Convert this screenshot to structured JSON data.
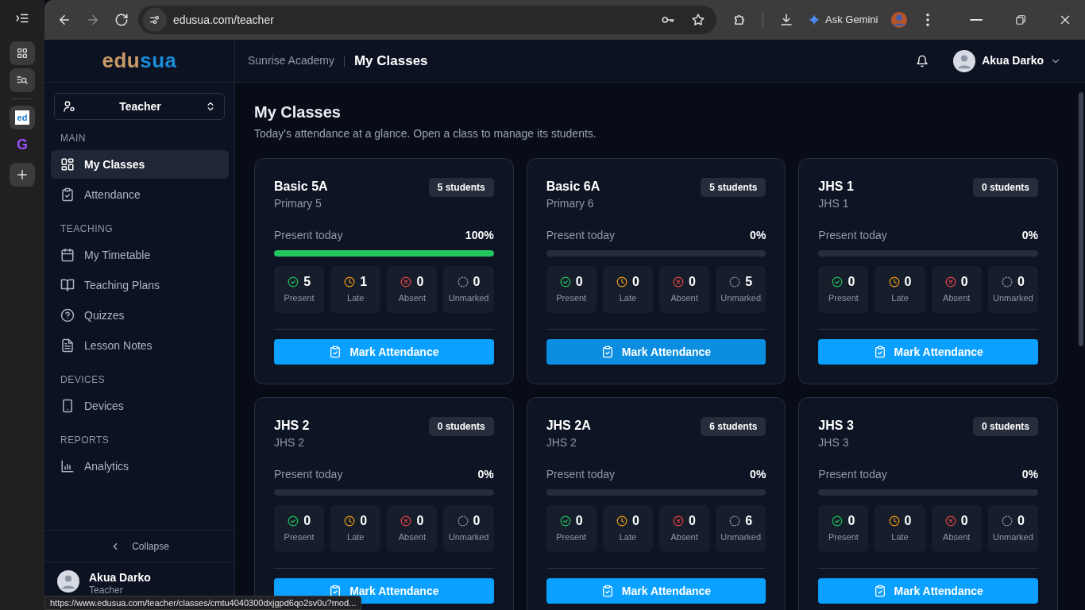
{
  "browser": {
    "tabs": [
      {
        "favicon": "ed",
        "kind": "edusua",
        "selected": true
      },
      {
        "favicon": "G",
        "kind": "purple",
        "selected": false
      }
    ],
    "url": "edusua.com/teacher",
    "assistant": "Ask Gemini",
    "status_url": "https://www.edusua.com/teacher/classes/cmtu4040300dxjgpd6qo2sv0u?mod..."
  },
  "sidebar": {
    "logo_first": "edu",
    "logo_second": "sua",
    "role": "Teacher",
    "sections": [
      {
        "title": "MAIN",
        "items": [
          {
            "label": "My Classes",
            "kind": "grid",
            "selected": true
          },
          {
            "label": "Attendance",
            "kind": "clipboard",
            "selected": false
          }
        ]
      },
      {
        "title": "TEACHING",
        "items": [
          {
            "label": "My Timetable",
            "kind": "calendar",
            "selected": false
          },
          {
            "label": "Teaching Plans",
            "kind": "book",
            "selected": false
          },
          {
            "label": "Quizzes",
            "kind": "help",
            "selected": false
          },
          {
            "label": "Lesson Notes",
            "kind": "file",
            "selected": false
          }
        ]
      },
      {
        "title": "DEVICES",
        "items": [
          {
            "label": "Devices",
            "kind": "phone",
            "selected": false
          }
        ]
      },
      {
        "title": "REPORTS",
        "items": [
          {
            "label": "Analytics",
            "kind": "chart",
            "selected": false
          }
        ]
      }
    ],
    "collapse": "Collapse",
    "user": {
      "name": "Akua Darko",
      "role": "Teacher"
    }
  },
  "header": {
    "school": "Sunrise Academy",
    "title": "My Classes",
    "user": "Akua Darko"
  },
  "page": {
    "title": "My Classes",
    "subtitle": "Today's attendance at a glance. Open a class to manage its students."
  },
  "classes": [
    {
      "name": "Basic 5A",
      "grade": "Primary 5",
      "students": "5 students",
      "present_label": "Present today",
      "percent": "100%",
      "level": 1,
      "hovered": false,
      "stats": [
        {
          "kind": "present",
          "value": "5",
          "label": "Present"
        },
        {
          "kind": "late",
          "value": "1",
          "label": "Late"
        },
        {
          "kind": "absent",
          "value": "0",
          "label": "Absent"
        },
        {
          "kind": "unmarked",
          "value": "0",
          "label": "Unmarked"
        }
      ],
      "button": "Mark Attendance"
    },
    {
      "name": "Basic 6A",
      "grade": "Primary 6",
      "students": "5 students",
      "present_label": "Present today",
      "percent": "0%",
      "level": 0,
      "hovered": true,
      "stats": [
        {
          "kind": "present",
          "value": "0",
          "label": "Present"
        },
        {
          "kind": "late",
          "value": "0",
          "label": "Late"
        },
        {
          "kind": "absent",
          "value": "0",
          "label": "Absent"
        },
        {
          "kind": "unmarked",
          "value": "5",
          "label": "Unmarked"
        }
      ],
      "button": "Mark Attendance"
    },
    {
      "name": "JHS 1",
      "grade": "JHS 1",
      "students": "0 students",
      "present_label": "Present today",
      "percent": "0%",
      "level": 0,
      "hovered": false,
      "stats": [
        {
          "kind": "present",
          "value": "0",
          "label": "Present"
        },
        {
          "kind": "late",
          "value": "0",
          "label": "Late"
        },
        {
          "kind": "absent",
          "value": "0",
          "label": "Absent"
        },
        {
          "kind": "unmarked",
          "value": "0",
          "label": "Unmarked"
        }
      ],
      "button": "Mark Attendance"
    },
    {
      "name": "JHS 2",
      "grade": "JHS 2",
      "students": "0 students",
      "present_label": "Present today",
      "percent": "0%",
      "level": 0,
      "hovered": false,
      "stats": [
        {
          "kind": "present",
          "value": "0",
          "label": "Present"
        },
        {
          "kind": "late",
          "value": "0",
          "label": "Late"
        },
        {
          "kind": "absent",
          "value": "0",
          "label": "Absent"
        },
        {
          "kind": "unmarked",
          "value": "0",
          "label": "Unmarked"
        }
      ],
      "button": "Mark Attendance"
    },
    {
      "name": "JHS 2A",
      "grade": "JHS 2",
      "students": "6 students",
      "present_label": "Present today",
      "percent": "0%",
      "level": 0,
      "hovered": false,
      "stats": [
        {
          "kind": "present",
          "value": "0",
          "label": "Present"
        },
        {
          "kind": "late",
          "value": "0",
          "label": "Late"
        },
        {
          "kind": "absent",
          "value": "0",
          "label": "Absent"
        },
        {
          "kind": "unmarked",
          "value": "6",
          "label": "Unmarked"
        }
      ],
      "button": "Mark Attendance"
    },
    {
      "name": "JHS 3",
      "grade": "JHS 3",
      "students": "0 students",
      "present_label": "Present today",
      "percent": "0%",
      "level": 0,
      "hovered": false,
      "stats": [
        {
          "kind": "present",
          "value": "0",
          "label": "Present"
        },
        {
          "kind": "late",
          "value": "0",
          "label": "Late"
        },
        {
          "kind": "absent",
          "value": "0",
          "label": "Absent"
        },
        {
          "kind": "unmarked",
          "value": "0",
          "label": "Unmarked"
        }
      ],
      "button": "Mark Attendance"
    }
  ]
}
